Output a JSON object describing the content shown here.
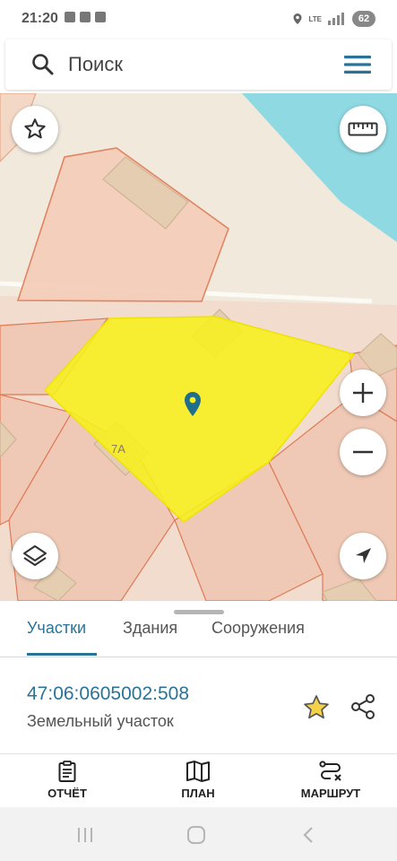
{
  "status_bar": {
    "time": "21:20",
    "network": "LTE",
    "battery": "62"
  },
  "search": {
    "placeholder": "Поиск"
  },
  "map": {
    "house_number": "7А"
  },
  "tabs": [
    {
      "label": "Участки",
      "active": true
    },
    {
      "label": "Здания",
      "active": false
    },
    {
      "label": "Сооружения",
      "active": false
    }
  ],
  "parcel": {
    "cadastral_number": "47:06:0605002:508",
    "type": "Земельный участок",
    "favorite": true
  },
  "bottom_nav": [
    {
      "label": "ОТЧЁТ",
      "icon": "report-icon"
    },
    {
      "label": "ПЛАН",
      "icon": "map-plan-icon"
    },
    {
      "label": "МАРШРУТ",
      "icon": "route-icon"
    }
  ],
  "colors": {
    "accent": "#2a7397",
    "selection": "#f7f01c",
    "parcel_border": "#e07a55",
    "water": "#8fd9e3",
    "favorite_star": "#f3d24a"
  }
}
